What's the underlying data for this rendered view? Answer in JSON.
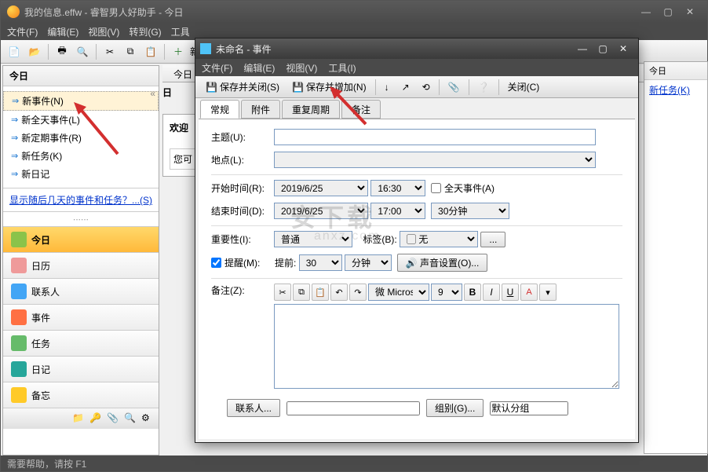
{
  "main": {
    "title": "我的信息.effw - 睿智男人好助手 - 今日",
    "menus": [
      "文件(F)",
      "编辑(E)",
      "视图(V)",
      "转到(G)",
      "工具",
      "..."
    ],
    "sidebar_header": "今日",
    "nav": [
      {
        "label": "新事件(N)"
      },
      {
        "label": "新全天事件(L)"
      },
      {
        "label": "新定期事件(R)"
      },
      {
        "label": "新任务(K)"
      },
      {
        "label": "新日记"
      }
    ],
    "hint": "显示随后几天的事件和任务？...(S)",
    "outlook": [
      {
        "label": "今日",
        "color": "#8bc34a"
      },
      {
        "label": "日历",
        "color": "#ef9a9a"
      },
      {
        "label": "联系人",
        "color": "#42a5f5"
      },
      {
        "label": "事件",
        "color": "#ff7043"
      },
      {
        "label": "任务",
        "color": "#66bb6a"
      },
      {
        "label": "日记",
        "color": "#26a69a"
      },
      {
        "label": "备忘",
        "color": "#ffca28"
      }
    ],
    "content_tab": "今日",
    "day_label": "日",
    "new_prefix": "新",
    "welcome_title": "欢迎",
    "welcome_text": "您可",
    "right_head": "今日",
    "right_link": "新任务(K)",
    "status": "需要帮助，请按 F1"
  },
  "dialog": {
    "title": "未命名 - 事件",
    "menus": [
      "文件(F)",
      "编辑(E)",
      "视图(V)",
      "工具(I)"
    ],
    "toolbar": {
      "save_close": "保存并关闭(S)",
      "save_add": "保存并增加(N)",
      "close": "关闭(C)"
    },
    "tabs": [
      "常规",
      "附件",
      "重复周期",
      "备注"
    ],
    "form": {
      "subject_label": "主题(U):",
      "subject_value": "",
      "location_label": "地点(L):",
      "location_value": "",
      "start_label": "开始时间(R):",
      "start_date": "2019/6/25",
      "start_time": "16:30",
      "allday_label": "全天事件(A)",
      "end_label": "结束时间(D):",
      "end_date": "2019/6/25",
      "end_time": "17:00",
      "duration": "30分钟",
      "importance_label": "重要性(I):",
      "importance_value": "普通",
      "tag_label": "标签(B):",
      "tag_value": "无",
      "tag_more": "...",
      "remind_label": "提醒(M):",
      "remind_before_label": "提前:",
      "remind_num": "30",
      "remind_unit": "分钟",
      "sound_btn": "声音设置(O)...",
      "notes_label": "备注(Z):",
      "font_name": "微 Microsc",
      "font_size": "9",
      "contact_btn": "联系人...",
      "group_btn": "组别(G)...",
      "group_default": "默认分组"
    }
  }
}
